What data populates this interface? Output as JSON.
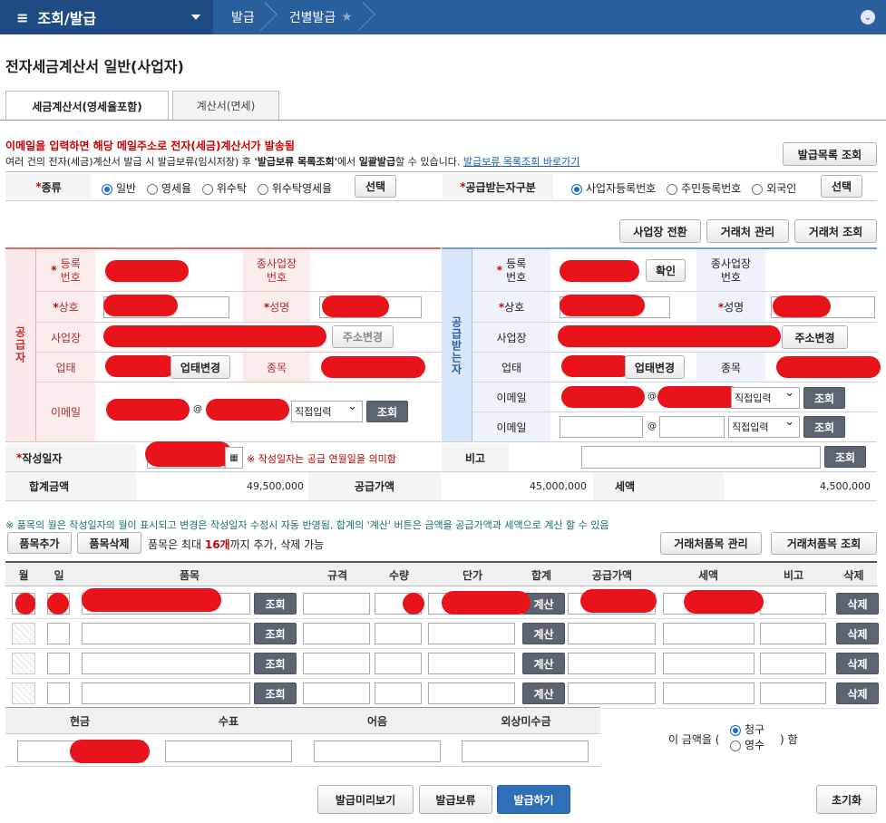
{
  "topbar": {
    "menu_title": "조회/발급",
    "crumb1": "발급",
    "crumb2": "건별발급",
    "star": "★",
    "chevron": "⌄"
  },
  "title": "전자세금계산서 일반(사업자)",
  "tabs": [
    "세금계산서(영세율포함)",
    "계산서(면세)"
  ],
  "notice": {
    "line1": "이메일을 입력하면 해당 메일주소로 전자(세금)계산서가 발송됨",
    "line2_pre": "여러 건의 전자(세금)계산서 발급 시 발급보류(임시저장) 후 ",
    "line2_bold1": "'발급보류 목록조회'",
    "line2_mid": "에서 ",
    "line2_bold2": "일괄발급",
    "line2_post": "할 수 있습니다.",
    "link": "발급보류 목록조회 바로가기"
  },
  "buttons": {
    "hold_list": "발급목록 조회",
    "select": "선택",
    "select2": "선택",
    "biz_switch": "사업장 전환",
    "client_manage": "거래처 관리",
    "client_search": "거래처 조회",
    "addr_change": "주소변경",
    "addr_change2": "주소변경",
    "biz_change": "업태변경",
    "biz_change2": "업태변경",
    "confirm": "확인",
    "search": "조회",
    "add_item": "품목추가",
    "del_item": "품목삭제",
    "client_item_manage": "거래처품목 관리",
    "client_item_search": "거래처품목 조회",
    "calc": "계산",
    "delete": "삭제",
    "preview": "발급미리보기",
    "hold": "발급보류",
    "issue": "발급하기",
    "reset": "초기화"
  },
  "kind": {
    "label": "종류",
    "options": [
      "일반",
      "영세율",
      "위수탁",
      "위수탁영세율"
    ],
    "selected": 0
  },
  "recv_kind": {
    "label": "공급받는자구분",
    "options": [
      "사업자등록번호",
      "주민등록번호",
      "외국인"
    ],
    "selected": 0
  },
  "supplier": {
    "side": "공급자",
    "reg_no": "등록\n번호",
    "sub_biz": "종사업장\n번호",
    "name": "상호",
    "ceo": "성명",
    "address": "사업장",
    "biz_type": "업태",
    "item": "종목",
    "email": "이메일",
    "email_select": "직접입력"
  },
  "receiver": {
    "side": "공급받는자",
    "reg_no": "등록\n번호",
    "sub_biz": "종사업장\n번호",
    "name": "상호",
    "ceo": "성명",
    "address": "사업장",
    "biz_type": "업태",
    "item": "종목",
    "email": "이메일",
    "email2": "이메일",
    "email_select": "직접입력",
    "email_select2": "직접입력"
  },
  "date": {
    "label": "작성일자",
    "note": "※ 작성일자는 공급 연월일을 의미함",
    "remark_label": "비고"
  },
  "totals": {
    "total_label": "합계금액",
    "total": "49,500,000",
    "supply_label": "공급가액",
    "supply": "45,000,000",
    "tax_label": "세액",
    "tax": "4,500,000"
  },
  "item_notice": "※ 품목의 월은 작성일자의 월이 표시되고 변경은 작성일자 수정시 자동 반영됨, 합계의 '계산' 버튼은 금액을 공급가액과 세액으로 계산 할 수 있음",
  "item_limit": {
    "pre": "품목은 최대 ",
    "count": "16개",
    "post": "까지 추가, 삭제 가능"
  },
  "table_headers": [
    "월",
    "일",
    "품목",
    "규격",
    "수량",
    "단가",
    "합계",
    "공급가액",
    "세액",
    "비고",
    "삭제"
  ],
  "payment": {
    "headers": [
      "현금",
      "수표",
      "어음",
      "외상미수금"
    ],
    "amount_pre": "이 금액을 (",
    "options": [
      "청구",
      "영수"
    ],
    "amount_post": ") 함"
  },
  "colors": {
    "topbar": "#2a5f9e",
    "redact": "#e8131b",
    "supplier_border": "#e06666",
    "receiver_border": "#6d9eeb"
  }
}
